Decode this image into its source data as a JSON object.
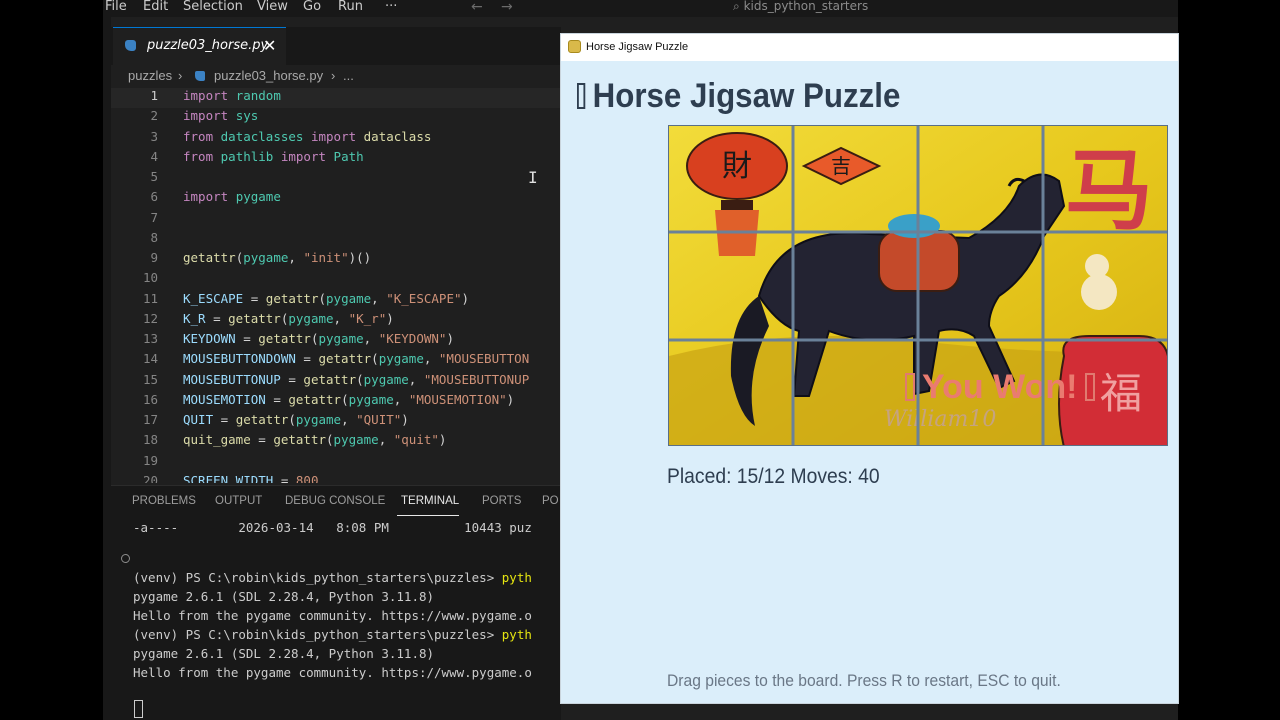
{
  "vscode": {
    "menu": [
      "File",
      "Edit",
      "Selection",
      "View",
      "Go",
      "Run",
      "···"
    ],
    "search_text": "kids_python_starters",
    "tab": {
      "filename": "puzzle03_horse.py",
      "close_glyph": "✕"
    },
    "breadcrumb": {
      "folder": "puzzles",
      "file": "puzzle03_horse.py",
      "more": "..."
    },
    "cursor_glyph": "I",
    "code_lines": [
      {
        "n": "1",
        "html": "<span class=\"kw\">import</span> <span class=\"cls\">random</span>"
      },
      {
        "n": "2",
        "html": "<span class=\"kw\">import</span> <span class=\"cls\">sys</span>"
      },
      {
        "n": "3",
        "html": "<span class=\"kw\">from</span> <span class=\"cls\">dataclasses</span> <span class=\"kw\">import</span> <span class=\"fn\">dataclass</span>"
      },
      {
        "n": "4",
        "html": "<span class=\"kw\">from</span> <span class=\"cls\">pathlib</span> <span class=\"kw\">import</span> <span class=\"cls\">Path</span>"
      },
      {
        "n": "5",
        "html": ""
      },
      {
        "n": "6",
        "html": "<span class=\"kw\">import</span> <span class=\"cls\">pygame</span>"
      },
      {
        "n": "7",
        "html": ""
      },
      {
        "n": "8",
        "html": ""
      },
      {
        "n": "9",
        "html": "<span class=\"fn\">getattr</span>(<span class=\"cls\">pygame</span>, <span class=\"str\">\"init\"</span>)()"
      },
      {
        "n": "10",
        "html": ""
      },
      {
        "n": "11",
        "html": "<span class=\"id\">K_ESCAPE</span> = <span class=\"fn\">getattr</span>(<span class=\"cls\">pygame</span>, <span class=\"str\">\"K_ESCAPE\"</span>)"
      },
      {
        "n": "12",
        "html": "<span class=\"id\">K_R</span> = <span class=\"fn\">getattr</span>(<span class=\"cls\">pygame</span>, <span class=\"str\">\"K_r\"</span>)"
      },
      {
        "n": "13",
        "html": "<span class=\"id\">KEYDOWN</span> = <span class=\"fn\">getattr</span>(<span class=\"cls\">pygame</span>, <span class=\"str\">\"KEYDOWN\"</span>)"
      },
      {
        "n": "14",
        "html": "<span class=\"id\">MOUSEBUTTONDOWN</span> = <span class=\"fn\">getattr</span>(<span class=\"cls\">pygame</span>, <span class=\"str\">\"MOUSEBUTTON</span>"
      },
      {
        "n": "15",
        "html": "<span class=\"id\">MOUSEBUTTONUP</span> = <span class=\"fn\">getattr</span>(<span class=\"cls\">pygame</span>, <span class=\"str\">\"MOUSEBUTTONUP</span>"
      },
      {
        "n": "16",
        "html": "<span class=\"id\">MOUSEMOTION</span> = <span class=\"fn\">getattr</span>(<span class=\"cls\">pygame</span>, <span class=\"str\">\"MOUSEMOTION\"</span>)"
      },
      {
        "n": "17",
        "html": "<span class=\"id\">QUIT</span> = <span class=\"fn\">getattr</span>(<span class=\"cls\">pygame</span>, <span class=\"str\">\"QUIT\"</span>)"
      },
      {
        "n": "18",
        "html": "<span class=\"fn\">quit_game</span> = <span class=\"fn\">getattr</span>(<span class=\"cls\">pygame</span>, <span class=\"str\">\"quit\"</span>)"
      },
      {
        "n": "19",
        "html": ""
      },
      {
        "n": "20",
        "html": "<span class=\"id\">SCREEN_WIDTH</span> = <span class=\"str\">800</span>"
      }
    ],
    "panel_tabs": [
      "PROBLEMS",
      "OUTPUT",
      "DEBUG CONSOLE",
      "TERMINAL",
      "PORTS",
      "PO"
    ],
    "terminal_lines": [
      {
        "html": "-a----        2026-03-14   8:08 PM          10443 puz"
      },
      {
        "html": ""
      },
      {
        "html": ""
      },
      {
        "html": "(venv) PS C:\\robin\\kids_python_starters\\puzzles> <span class=\"yel\">pyth</span>"
      },
      {
        "html": "pygame 2.6.1 (SDL 2.28.4, Python 3.11.8)"
      },
      {
        "html": "Hello from the pygame community. https://www.pygame.o"
      },
      {
        "html": "(venv) PS C:\\robin\\kids_python_starters\\puzzles> <span class=\"yel\">pyth</span>"
      },
      {
        "html": "pygame 2.6.1 (SDL 2.28.4, Python 3.11.8)"
      },
      {
        "html": "Hello from the pygame community. https://www.pygame.o"
      }
    ]
  },
  "game": {
    "window_title": "Horse Jigsaw Puzzle",
    "heading": "Horse Jigsaw Puzzle",
    "board": {
      "signature": "William10",
      "win_message": "You Won!",
      "fu_char": "福",
      "cai_char": "財",
      "ji_char": "吉",
      "ma_char": "马"
    },
    "status": "Placed: 15/12  Moves: 40",
    "hint": "Drag pieces to the board. Press R to restart, ESC to quit."
  }
}
